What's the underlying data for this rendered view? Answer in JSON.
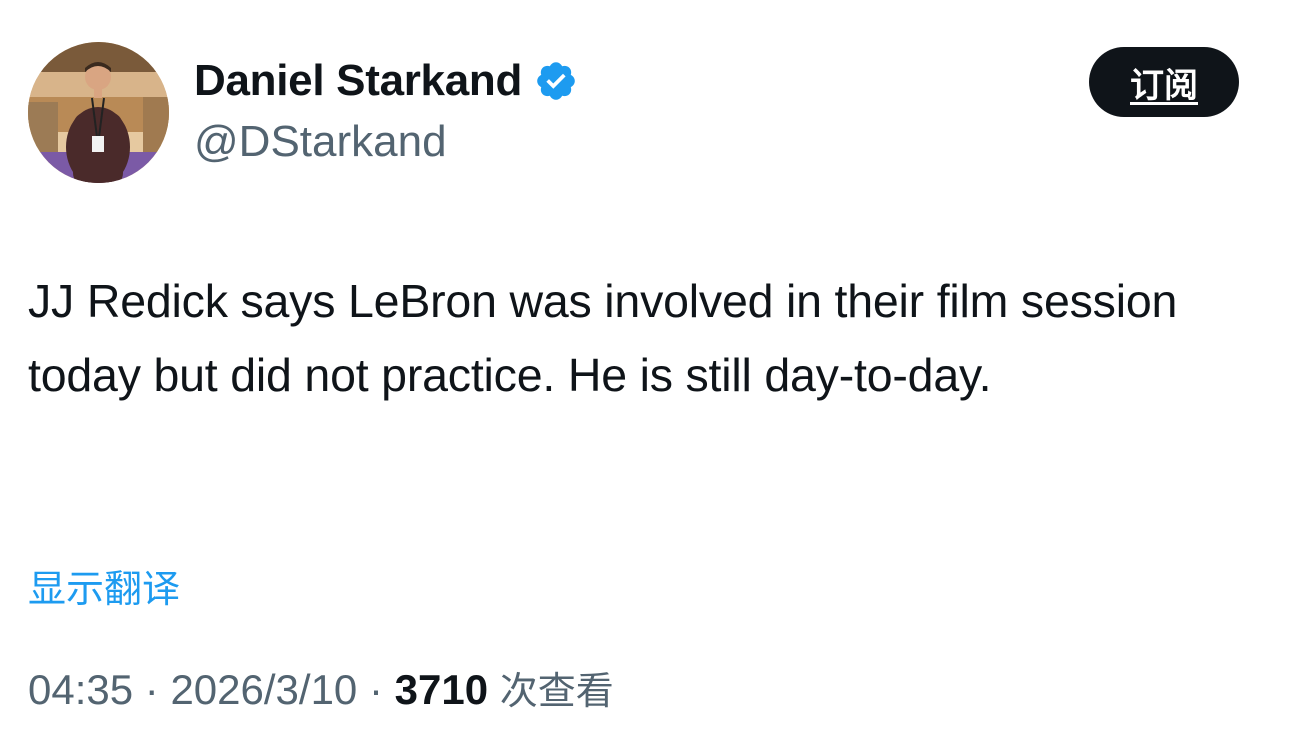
{
  "author": {
    "display_name": "Daniel Starkand",
    "handle": "@DStarkand",
    "verified_icon": "verified-badge-icon"
  },
  "actions": {
    "subscribe_label": "订阅"
  },
  "tweet": {
    "text": "JJ Redick says LeBron was involved in their film session today but did not practice. He is still day-to-day.",
    "translate_label": "显示翻译"
  },
  "meta": {
    "time": "04:35",
    "separator": " · ",
    "date": "2026/3/10",
    "views_count": "3710",
    "views_label": "次查看"
  },
  "colors": {
    "text": "#0f1419",
    "secondary": "#536471",
    "link": "#1d9bf0",
    "verified": "#1d9bf0",
    "button_bg": "#0f1419"
  }
}
